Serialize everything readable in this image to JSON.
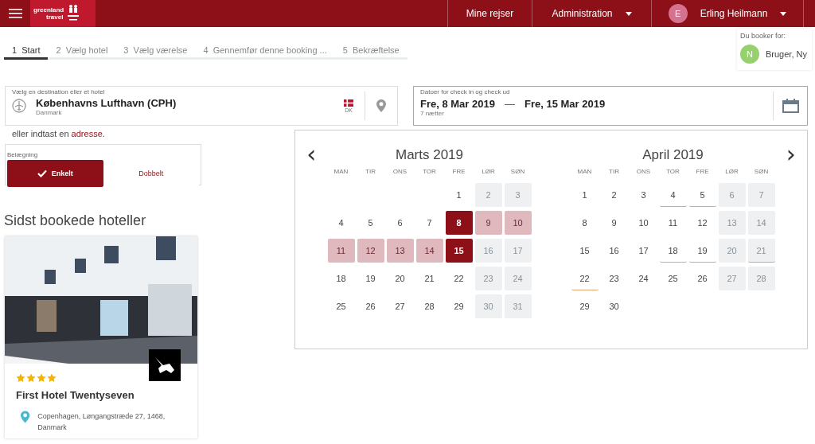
{
  "header": {
    "logo": {
      "line1": "greenland",
      "line2": "travel"
    },
    "nav": [
      {
        "label": "Mine rejser",
        "kind": "link"
      },
      {
        "label": "Administration",
        "kind": "dropdown"
      }
    ],
    "user": {
      "initial": "E",
      "name": "Erling Heilmann"
    }
  },
  "steps": [
    {
      "number": "1",
      "label": "Start",
      "selected": true
    },
    {
      "number": "2",
      "label": "Vælg hotel",
      "selected": false
    },
    {
      "number": "3",
      "label": "Vælg værelse",
      "selected": false
    },
    {
      "number": "4",
      "label": "Gennemfør denne booking ...",
      "selected": false
    },
    {
      "number": "5",
      "label": "Bekræftelse",
      "selected": false
    }
  ],
  "booking_for": {
    "label": "Du booker for:",
    "initial": "N",
    "name": "Bruger, Ny"
  },
  "destination": {
    "label": "Vælg en destination eller et hotel",
    "value": "Københavns Lufthavn (CPH)",
    "country": "Danmark",
    "country_code": "DK"
  },
  "address_hint": {
    "text": "eller indtast en",
    "link": "adresse",
    "end": "."
  },
  "dates": {
    "label": "Datoer for check in og check ud",
    "check_in": "Fre, 8 Mar 2019",
    "separator": "—",
    "check_out": "Fre, 15 Mar 2019",
    "nights": "7 nætter"
  },
  "occupancy": {
    "label": "Belægning",
    "options": [
      {
        "label": "Enkelt",
        "selected": true
      },
      {
        "label": "Dobbelt",
        "selected": false
      }
    ]
  },
  "recent": {
    "title": "Sidst bookede hoteller",
    "hotels": [
      {
        "kind": "picture",
        "stars": 4,
        "name": "First Hotel Twentyseven",
        "address": "Copenhagen, Løngangstræde 27, 1468, Danmark"
      }
    ]
  },
  "calendar": {
    "prev": "‹",
    "next": "›",
    "months": [
      {
        "title": "Marts 2019",
        "weekdays": [
          "MAN",
          "TIR",
          "ONS",
          "TOR",
          "FRE",
          "LØR",
          "SØN"
        ],
        "days": [
          {
            "kind": "blank"
          },
          {
            "kind": "blank"
          },
          {
            "kind": "blank"
          },
          {
            "kind": "blank"
          },
          {
            "day": "1",
            "kind": "day",
            "marked": false
          },
          {
            "day": "2",
            "kind": "weekend",
            "marked": false
          },
          {
            "day": "3",
            "kind": "weekend",
            "marked": false
          },
          {
            "day": "4",
            "kind": "day",
            "marked": false
          },
          {
            "day": "5",
            "kind": "day",
            "marked": false
          },
          {
            "day": "6",
            "kind": "day",
            "marked": false
          },
          {
            "day": "7",
            "kind": "day",
            "marked": false
          },
          {
            "day": "8",
            "kind": "edge",
            "marked": false
          },
          {
            "day": "9",
            "kind": "range",
            "marked": false
          },
          {
            "day": "10",
            "kind": "range",
            "marked": false
          },
          {
            "day": "11",
            "kind": "range",
            "marked": false
          },
          {
            "day": "12",
            "kind": "range",
            "marked": false
          },
          {
            "day": "13",
            "kind": "range",
            "marked": false
          },
          {
            "day": "14",
            "kind": "range",
            "marked": false
          },
          {
            "day": "15",
            "kind": "edge",
            "marked": false
          },
          {
            "day": "16",
            "kind": "weekend",
            "marked": false
          },
          {
            "day": "17",
            "kind": "weekend",
            "marked": false
          },
          {
            "day": "18",
            "kind": "day",
            "marked": false
          },
          {
            "day": "19",
            "kind": "day",
            "marked": false
          },
          {
            "day": "20",
            "kind": "day",
            "marked": false
          },
          {
            "day": "21",
            "kind": "day",
            "marked": false
          },
          {
            "day": "22",
            "kind": "day",
            "marked": false
          },
          {
            "day": "23",
            "kind": "weekend",
            "marked": false
          },
          {
            "day": "24",
            "kind": "weekend",
            "marked": false
          },
          {
            "day": "25",
            "kind": "day",
            "marked": false
          },
          {
            "day": "26",
            "kind": "day",
            "marked": false
          },
          {
            "day": "27",
            "kind": "day",
            "marked": false
          },
          {
            "day": "28",
            "kind": "day",
            "marked": false
          },
          {
            "day": "29",
            "kind": "day",
            "marked": false
          },
          {
            "day": "30",
            "kind": "weekend",
            "marked": false
          },
          {
            "day": "31",
            "kind": "weekend",
            "marked": false
          }
        ]
      },
      {
        "title": "April 2019",
        "weekdays": [
          "MAN",
          "TIR",
          "ONS",
          "TOR",
          "FRE",
          "LØR",
          "SØN"
        ],
        "days": [
          {
            "day": "1",
            "kind": "day",
            "marked": false
          },
          {
            "day": "2",
            "kind": "day",
            "marked": false
          },
          {
            "day": "3",
            "kind": "day",
            "marked": false
          },
          {
            "day": "4",
            "kind": "day",
            "marked": true
          },
          {
            "day": "5",
            "kind": "day",
            "marked": true
          },
          {
            "day": "6",
            "kind": "weekend",
            "marked": false
          },
          {
            "day": "7",
            "kind": "weekend",
            "marked": false
          },
          {
            "day": "8",
            "kind": "day",
            "marked": false
          },
          {
            "day": "9",
            "kind": "day",
            "marked": false
          },
          {
            "day": "10",
            "kind": "day",
            "marked": false
          },
          {
            "day": "11",
            "kind": "day",
            "marked": false
          },
          {
            "day": "12",
            "kind": "day",
            "marked": false
          },
          {
            "day": "13",
            "kind": "weekend",
            "marked": false
          },
          {
            "day": "14",
            "kind": "weekend",
            "marked": false
          },
          {
            "day": "15",
            "kind": "day",
            "marked": false
          },
          {
            "day": "16",
            "kind": "day",
            "marked": false
          },
          {
            "day": "17",
            "kind": "day",
            "marked": false
          },
          {
            "day": "18",
            "kind": "day",
            "marked": true
          },
          {
            "day": "19",
            "kind": "day",
            "marked": true
          },
          {
            "day": "20",
            "kind": "weekend",
            "marked": false
          },
          {
            "day": "21",
            "kind": "weekend",
            "marked": true
          },
          {
            "day": "22",
            "kind": "day",
            "marked": true
          },
          {
            "day": "23",
            "kind": "day",
            "marked": false
          },
          {
            "day": "24",
            "kind": "day",
            "marked": false
          },
          {
            "day": "25",
            "kind": "day",
            "marked": false
          },
          {
            "day": "26",
            "kind": "day",
            "marked": false
          },
          {
            "day": "27",
            "kind": "weekend",
            "marked": false
          },
          {
            "day": "28",
            "kind": "weekend",
            "marked": false
          },
          {
            "day": "29",
            "kind": "day",
            "marked": false
          },
          {
            "day": "30",
            "kind": "day",
            "marked": false
          }
        ]
      }
    ]
  }
}
